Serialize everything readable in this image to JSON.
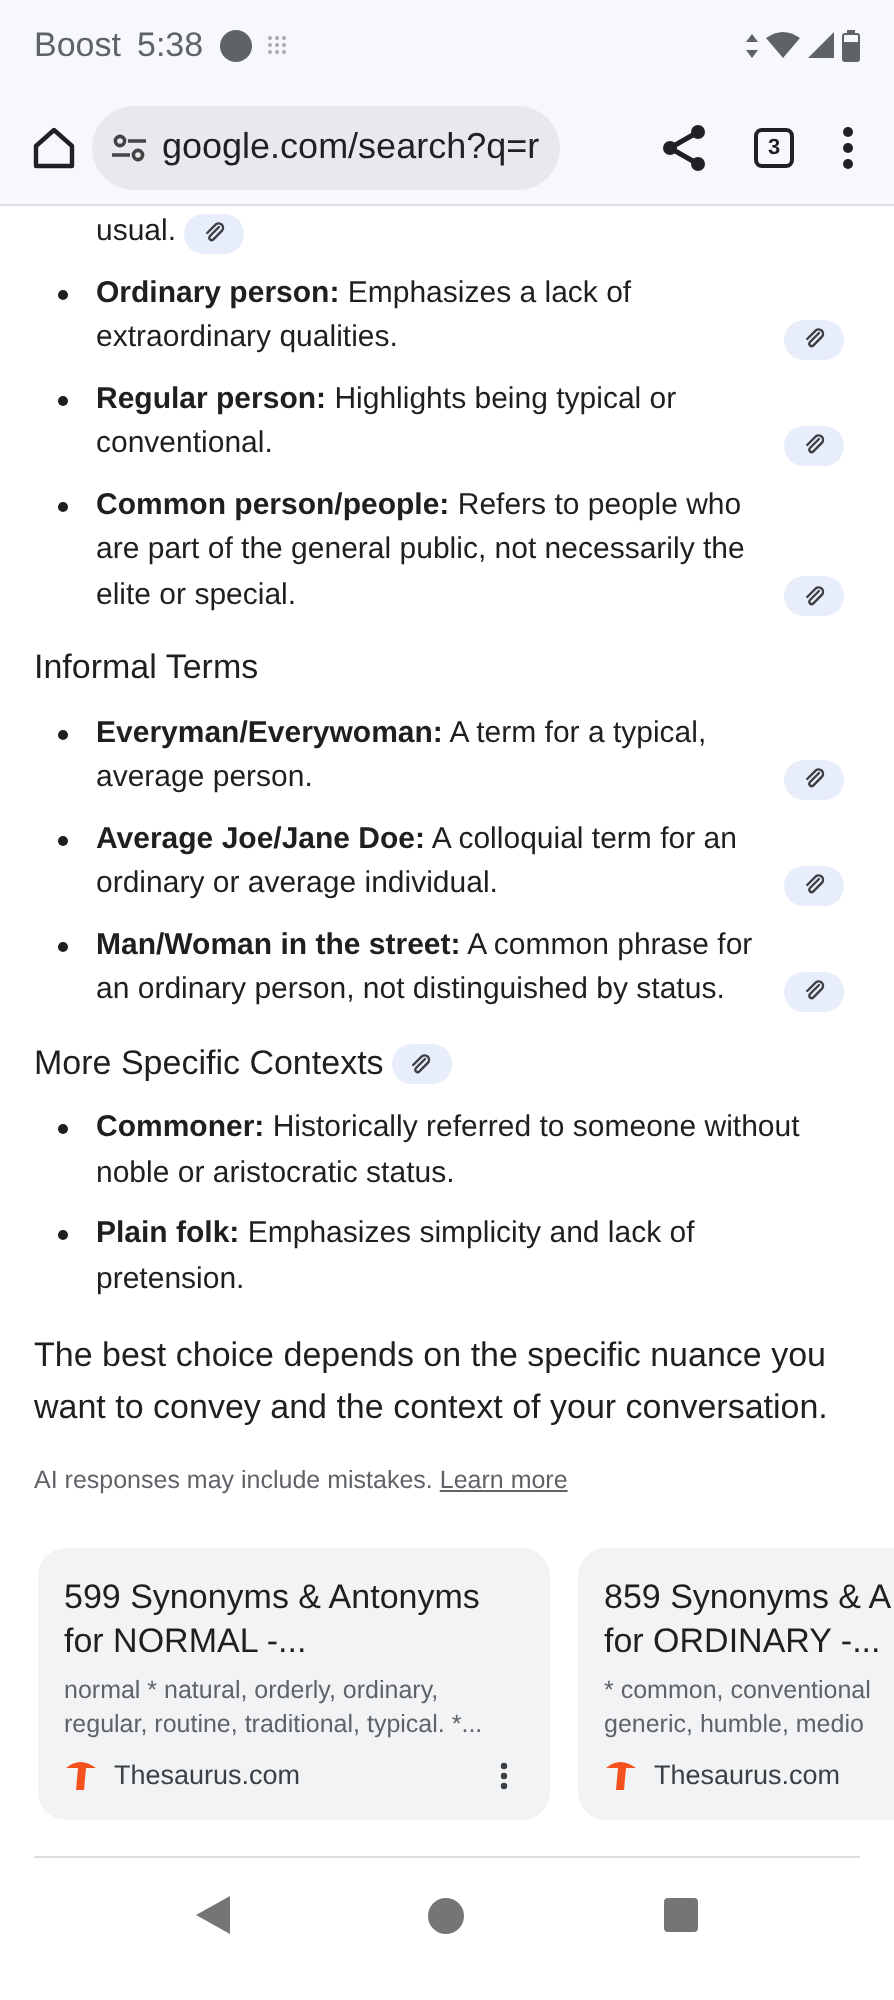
{
  "status_bar": {
    "carrier": "Boost",
    "time": "5:38"
  },
  "toolbar": {
    "url": "google.com/search?q=r",
    "tab_count": "3"
  },
  "lead_fragment": {
    "text": "usual.",
    "cited": true
  },
  "sections": [
    {
      "items": [
        {
          "term": "Ordinary person:",
          "text": "Emphasizes a lack of extraordinary qualities.",
          "cited": true
        },
        {
          "term": "Regular person:",
          "text": "Highlights being typical or conventional.",
          "cited": true
        },
        {
          "term": "Common person/people:",
          "text": "Refers to people who are part of the general public, not necessarily the elite or special.",
          "cited": true
        }
      ]
    },
    {
      "heading": "Informal Terms",
      "items": [
        {
          "term": "Everyman/Everywoman:",
          "text": "A term for a typical, average person.",
          "cited": true
        },
        {
          "term": "Average Joe/Jane Doe:",
          "text": "A colloquial term for an ordinary or average individual.",
          "cited": true
        },
        {
          "term": "Man/Woman in the street:",
          "text": "A common phrase for an ordinary person, not distinguished by status.",
          "cited": true
        }
      ]
    },
    {
      "heading": "More Specific Contexts",
      "cited": true,
      "items": [
        {
          "term": "Commoner:",
          "text": "Historically referred to someone without noble or aristocratic status.",
          "cited": false
        },
        {
          "term": "Plain folk:",
          "text": "Emphasizes simplicity and lack of pretension.",
          "cited": false
        }
      ]
    }
  ],
  "summary": "The best choice depends on the specific nuance you want to convey and the context of your conversation.",
  "disclaimer": {
    "text": "AI responses may include mistakes.",
    "link": "Learn more"
  },
  "cards": [
    {
      "title_lines": [
        "599 Synonyms & Antonyms",
        "for NORMAL -..."
      ],
      "snippet_lines": [
        "normal * natural, orderly, ordinary,",
        "regular, routine, traditional, typical. *..."
      ],
      "source": "Thesaurus.com",
      "menu": true
    },
    {
      "title_lines": [
        "859 Synonyms & A",
        "for ORDINARY -..."
      ],
      "snippet_lines": [
        "* common, conventional",
        "generic, humble, medio"
      ],
      "source": "Thesaurus.com"
    }
  ]
}
